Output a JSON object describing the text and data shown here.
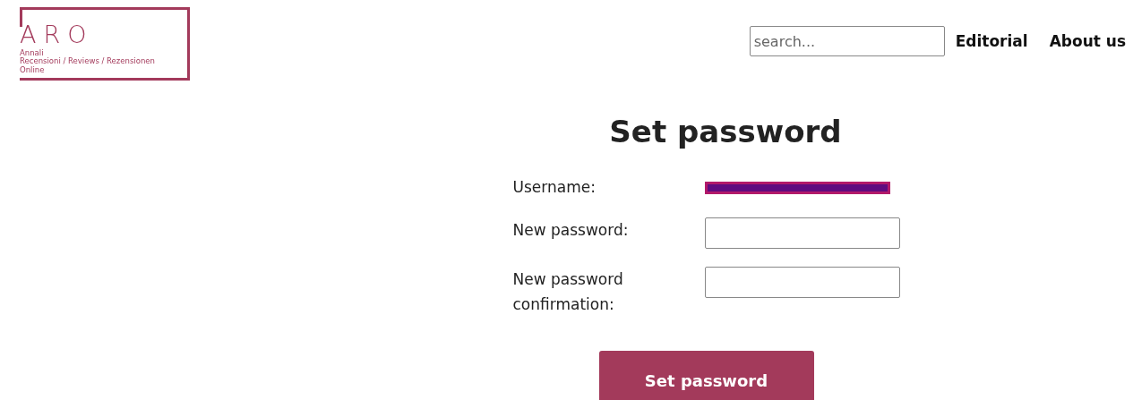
{
  "logo": {
    "mark": "ARO",
    "lines": [
      "Annali",
      "Recensioni / Reviews / Rezensionen",
      "Online"
    ]
  },
  "search": {
    "placeholder": "search..."
  },
  "nav": [
    "Editorial",
    "About us"
  ],
  "title": "Set password",
  "form": {
    "fields": [
      {
        "label": "Username:",
        "kind": "redacted"
      },
      {
        "label": "New password:",
        "kind": "input"
      },
      {
        "label": "New password confirmation:",
        "kind": "input"
      }
    ],
    "submit": "Set password"
  }
}
